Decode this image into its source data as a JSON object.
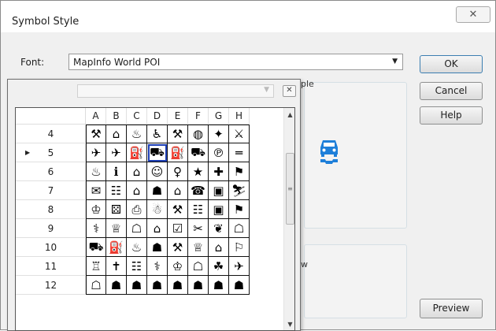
{
  "dialog": {
    "title": "Symbol Style",
    "close_glyph": "✕",
    "font_label": "Font:",
    "font_value": "MapInfo World POI",
    "buttons": {
      "ok": "OK",
      "cancel": "Cancel",
      "help": "Help",
      "preview": "Preview"
    },
    "sample_label": "ple",
    "preview_label": "w",
    "sample_symbol_icon": "car-repair-icon",
    "accent_color": "#1e7fd9"
  },
  "popup": {
    "bg_label": "Symbol",
    "close_glyph": "✕",
    "columns": [
      "A",
      "B",
      "C",
      "D",
      "E",
      "F",
      "G",
      "H"
    ],
    "current_row_marker": "▶",
    "rows": [
      {
        "num": "4",
        "current": false,
        "cells": [
          "⚒",
          "⌂",
          "♨",
          "♿",
          "⚒",
          "◍",
          "✦",
          "⚔"
        ]
      },
      {
        "num": "5",
        "current": true,
        "cells": [
          "✈",
          "✈",
          "⛽",
          "⛟",
          "⛽",
          "⛟",
          "℗",
          "═"
        ]
      },
      {
        "num": "6",
        "current": false,
        "cells": [
          "♨",
          "ℹ",
          "⌂",
          "☺",
          "♀",
          "★",
          "✚",
          "⚑"
        ]
      },
      {
        "num": "7",
        "current": false,
        "cells": [
          "✉",
          "☷",
          "⌂",
          "☗",
          "⌂",
          "☎",
          "▣",
          "⛷"
        ]
      },
      {
        "num": "8",
        "current": false,
        "cells": [
          "♔",
          "⚄",
          "⎙",
          "☃",
          "⚒",
          "☷",
          "▣",
          "⚑"
        ]
      },
      {
        "num": "9",
        "current": false,
        "cells": [
          "⚕",
          "♕",
          "☖",
          "⌂",
          "☑",
          "✂",
          "❦",
          "☖"
        ]
      },
      {
        "num": "10",
        "current": false,
        "cells": [
          "⛟",
          "⛽",
          "♨",
          "☗",
          "⚒",
          "♕",
          "⌂",
          "⚐"
        ]
      },
      {
        "num": "11",
        "current": false,
        "cells": [
          "♖",
          "✝",
          "☷",
          "⚕",
          "♔",
          "☖",
          "☘",
          "✈"
        ]
      },
      {
        "num": "12",
        "current": false,
        "cells": [
          "☖",
          "☗",
          "☗",
          "☗",
          "☗",
          "☗",
          "☗",
          "☗"
        ]
      }
    ],
    "selected": {
      "row": 1,
      "col": 3
    }
  }
}
